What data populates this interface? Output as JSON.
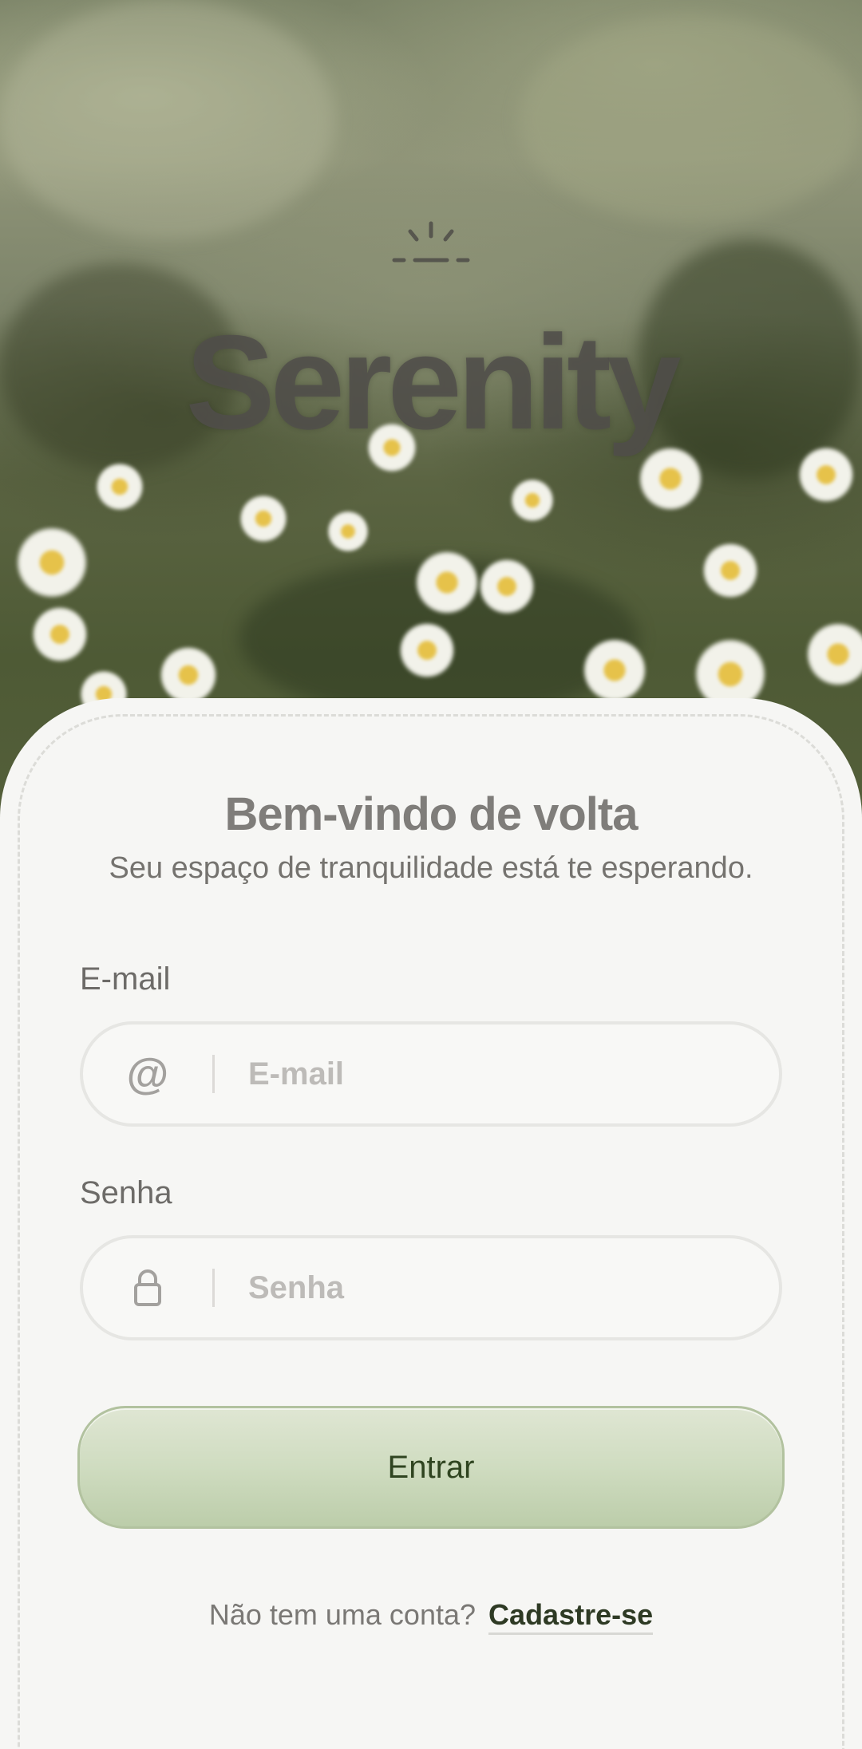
{
  "app": {
    "brand": "Serenity",
    "logo_icon": "sunrise-icon"
  },
  "login": {
    "title": "Bem-vindo de volta",
    "subtitle": "Seu espaço de tranquilidade está te esperando.",
    "email": {
      "label": "E-mail",
      "placeholder": "E-mail",
      "value": "",
      "icon": "at-icon"
    },
    "password": {
      "label": "Senha",
      "placeholder": "Senha",
      "value": "",
      "icon": "lock-icon"
    },
    "submit_label": "Entrar",
    "signup_prompt": "Não tem uma conta?",
    "signup_link": "Cadastre-se"
  },
  "colors": {
    "accent": "#cfdcc0",
    "accent_border": "#b2c29f",
    "accent_text": "#2f4420",
    "card_background": "#f6f6f4"
  }
}
